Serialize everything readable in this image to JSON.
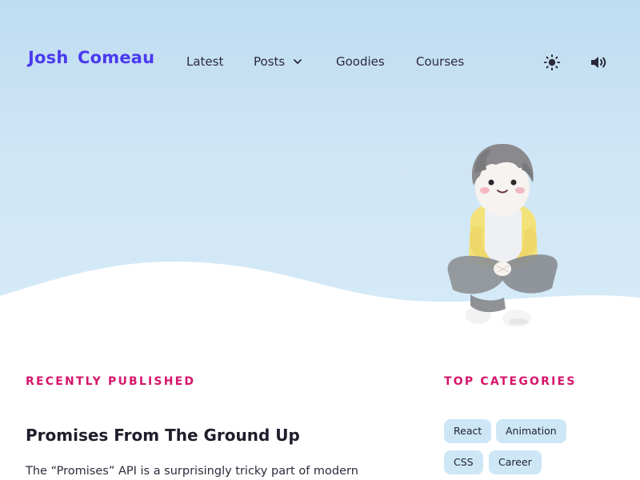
{
  "header": {
    "logo": "Josh Comeau",
    "nav": [
      {
        "label": "Latest"
      },
      {
        "label": "Posts",
        "has_dropdown": true
      },
      {
        "label": "Goodies"
      },
      {
        "label": "Courses"
      }
    ],
    "icons": {
      "theme_toggle": "sun-icon",
      "sound_toggle": "speaker-icon"
    }
  },
  "colors": {
    "brand": "#4a3aee",
    "accent": "#d6156b",
    "hero_bg": "#c9e3f5",
    "tag_bg": "#cde7f6"
  },
  "main": {
    "recent_heading": "RECENTLY PUBLISHED",
    "post": {
      "title": "Promises From The Ground Up",
      "excerpt": "The “Promises” API is a surprisingly tricky part of modern"
    }
  },
  "sidebar": {
    "heading": "TOP CATEGORIES",
    "tags": [
      "React",
      "Animation",
      "CSS",
      "Career"
    ]
  }
}
